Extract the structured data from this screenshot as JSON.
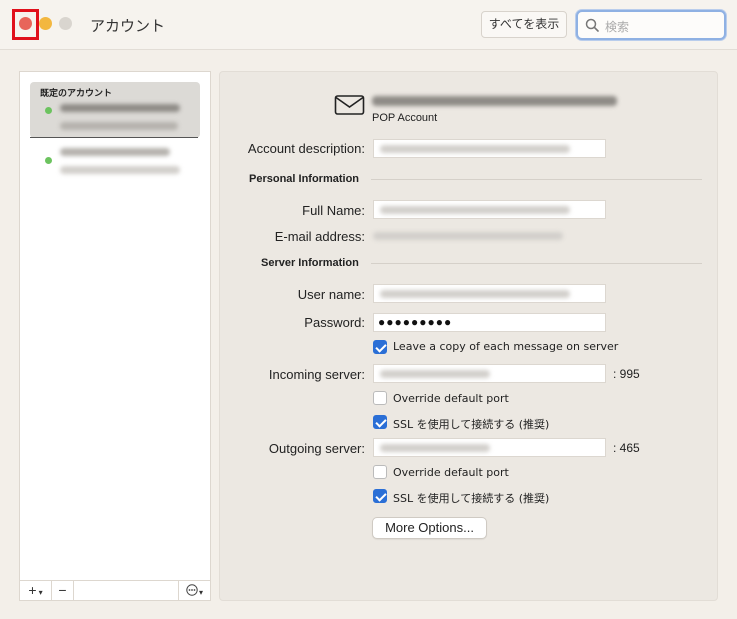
{
  "window": {
    "title": "アカウント",
    "show_all": "すべてを表示",
    "search_placeholder": "検索"
  },
  "sidebar": {
    "section_title": "既定のアカウント",
    "accounts": [
      {
        "status": "online",
        "selected": true
      },
      {
        "status": "online",
        "selected": false
      }
    ],
    "toolbar": {
      "add": "+",
      "remove": "−",
      "actions": "⋯"
    }
  },
  "account": {
    "type": "POP Account",
    "labels": {
      "description": "Account description:",
      "personal_info": "Personal Information",
      "full_name": "Full Name:",
      "email": "E-mail address:",
      "server_info": "Server Information",
      "user_name": "User name:",
      "password": "Password:",
      "incoming": "Incoming server:",
      "outgoing": "Outgoing server:"
    },
    "password_value": "●●●●●●●●●",
    "leave_copy": {
      "label": "Leave a copy of each message on server",
      "checked": true
    },
    "incoming_port": ": 995",
    "incoming_override": {
      "label": "Override default port",
      "checked": false
    },
    "incoming_ssl": {
      "label": "SSL を使用して接続する (推奨)",
      "checked": true
    },
    "outgoing_port": ": 465",
    "outgoing_override": {
      "label": "Override default port",
      "checked": false
    },
    "outgoing_ssl": {
      "label": "SSL を使用して接続する (推奨)",
      "checked": true
    },
    "more_options": "More Options..."
  },
  "colors": {
    "close": "#e8655a",
    "minimize": "#f3b73f",
    "zoom": "#d9d5cf",
    "accent": "#2b6fd6",
    "highlight": "#e0101b"
  }
}
